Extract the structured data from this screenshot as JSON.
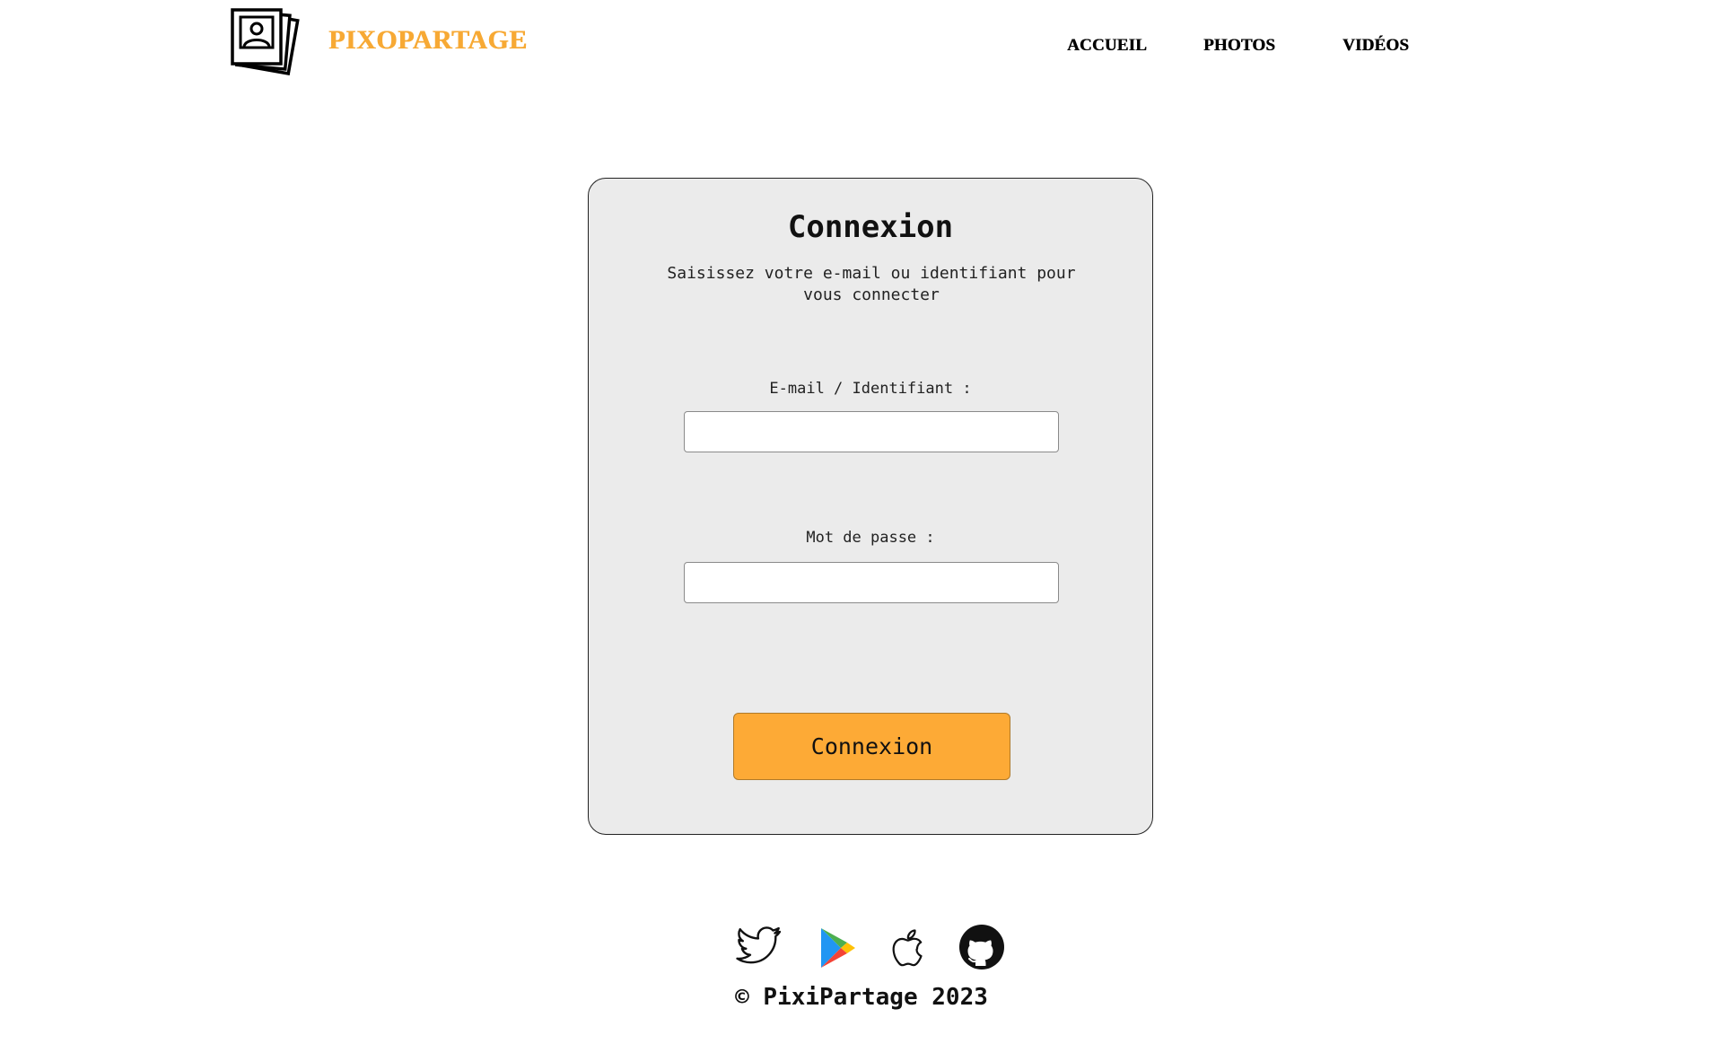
{
  "header": {
    "brand": "PIXOPARTAGE",
    "logo_icon": "photo-stack-icon",
    "nav": {
      "home": "ACCUEIL",
      "photos": "PHOTOS",
      "videos": "VIDÉOS"
    }
  },
  "login": {
    "title": "Connexion",
    "subtitle": "Saisissez votre e-mail ou identifiant pour vous connecter",
    "email_label": "E-mail / Identifiant :",
    "email_value": "",
    "password_label": "Mot de passe :",
    "password_value": "",
    "submit_label": "Connexion"
  },
  "footer": {
    "icons": [
      "twitter-icon",
      "google-play-icon",
      "apple-icon",
      "github-icon"
    ],
    "copyright": "© PixiPartage 2023"
  },
  "colors": {
    "brand": "#f7a934",
    "button": "#fdaa36",
    "card_background": "#ebebeb"
  }
}
